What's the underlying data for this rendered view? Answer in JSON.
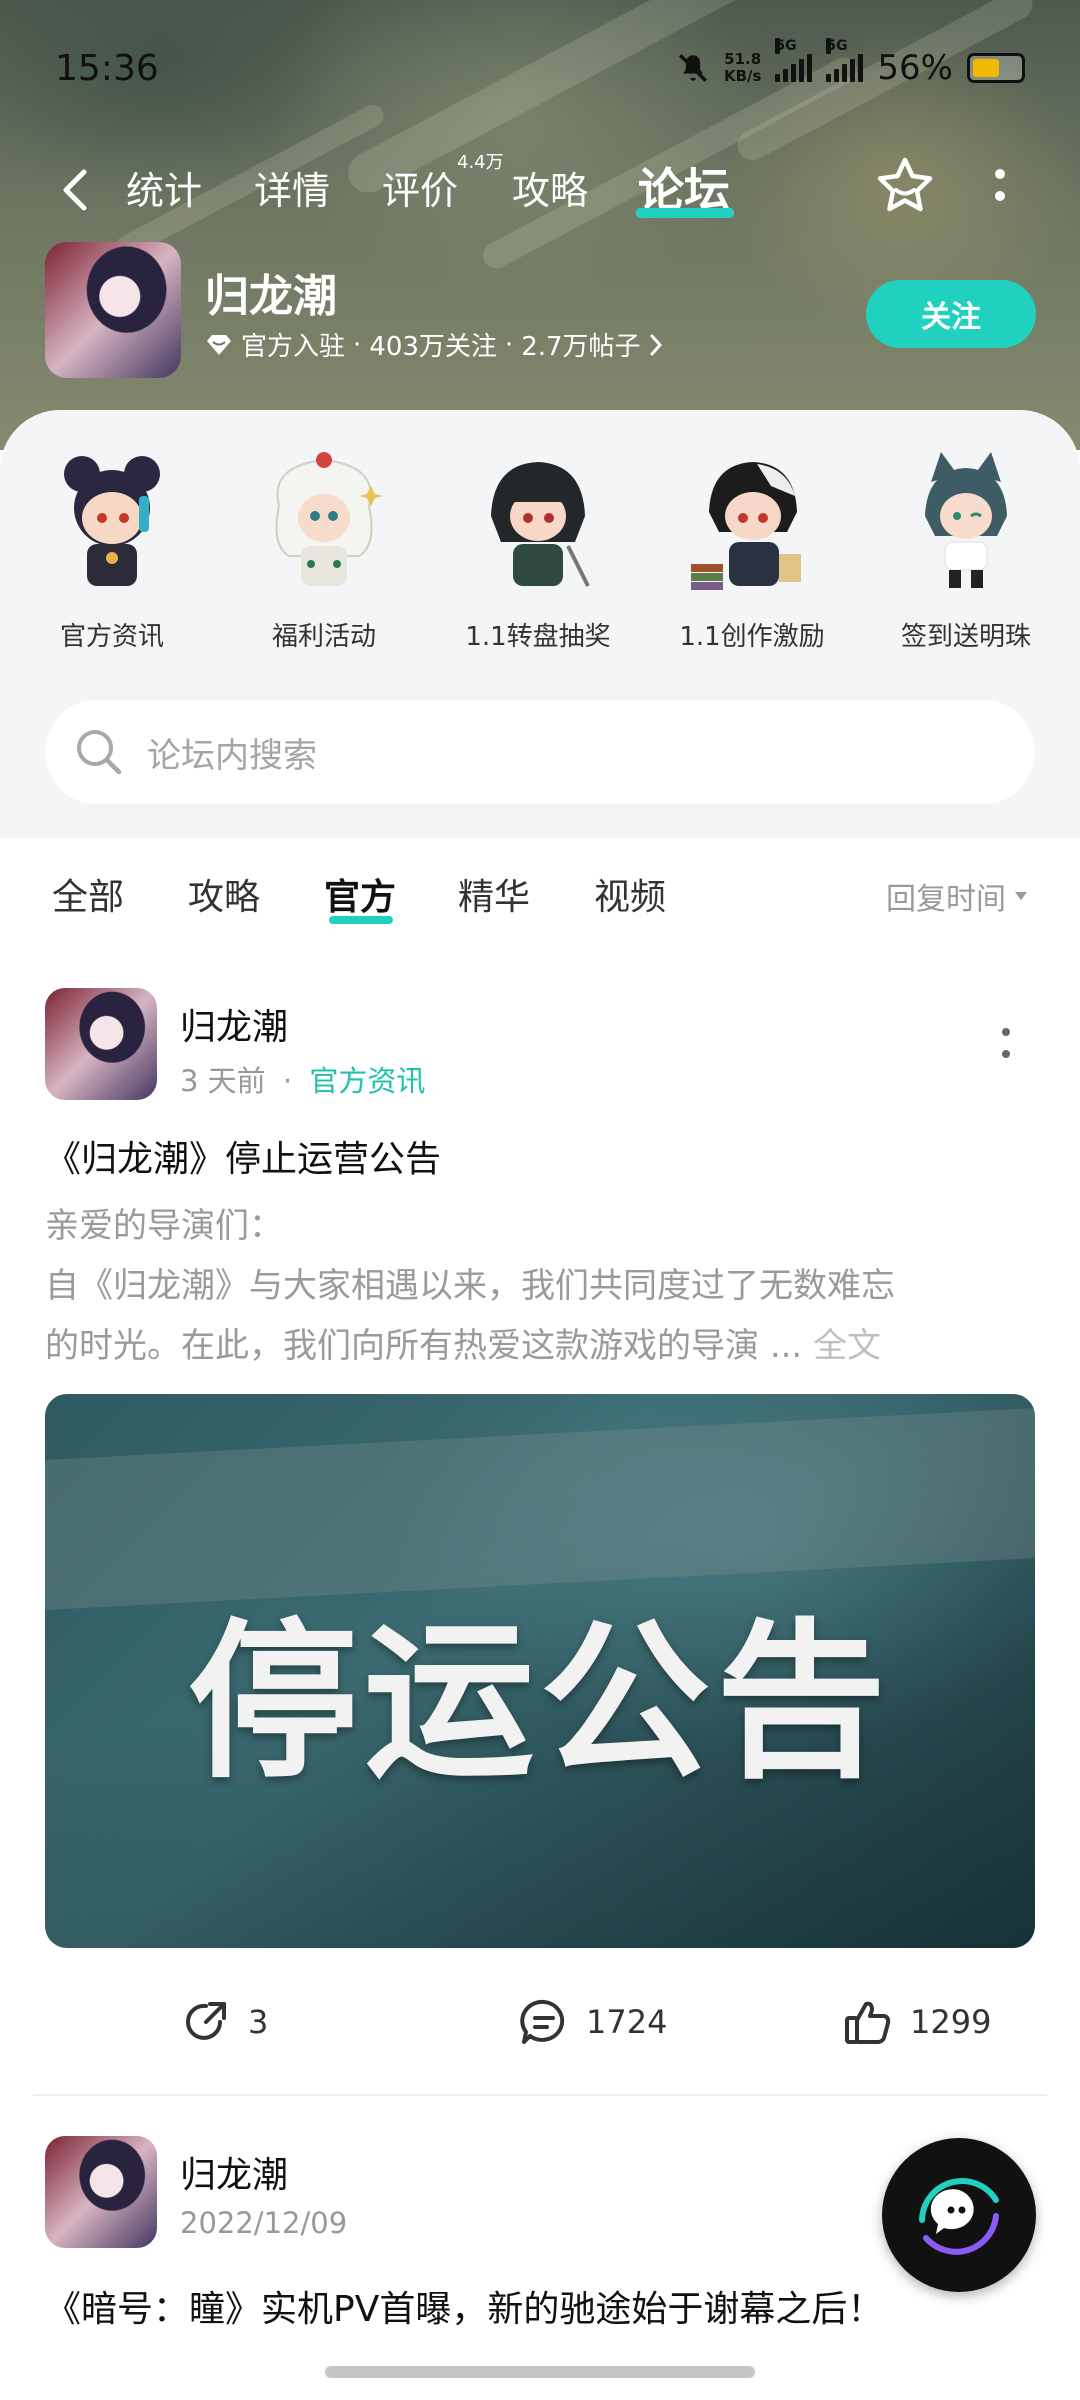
{
  "status_bar": {
    "time": "15:36",
    "net_speed_value": "51.8",
    "net_speed_unit": "KB/s",
    "signal_1": "5G",
    "signal_2": "5G",
    "battery": "56%"
  },
  "top_nav": {
    "tabs": [
      {
        "label": "统计"
      },
      {
        "label": "详情"
      },
      {
        "label": "评价"
      },
      {
        "label": "攻略"
      },
      {
        "label": "论坛"
      }
    ],
    "review_count_badge": "4.4万",
    "active_tab": "论坛"
  },
  "game": {
    "name": "归龙潮",
    "official": "官方入驻",
    "followers": "403万关注",
    "posts": "2.7万帖子",
    "separator": "·",
    "follow_label": "关注"
  },
  "shortcuts": [
    {
      "label": "官方资讯",
      "icon": "chibi-girl-buns"
    },
    {
      "label": "福利活动",
      "icon": "chibi-lion-dance"
    },
    {
      "label": "1.1转盘抽奖",
      "icon": "chibi-dark-hair"
    },
    {
      "label": "1.1创作激励",
      "icon": "chibi-boy-books"
    },
    {
      "label": "签到送明珠",
      "icon": "chibi-cat-girl"
    }
  ],
  "search": {
    "placeholder": "论坛内搜索"
  },
  "filters": {
    "tabs": [
      {
        "label": "全部"
      },
      {
        "label": "攻略"
      },
      {
        "label": "官方"
      },
      {
        "label": "精华"
      },
      {
        "label": "视频"
      }
    ],
    "active": "官方",
    "sort_label": "回复时间"
  },
  "posts": [
    {
      "author": "归龙潮",
      "time": "3 天前",
      "dot": "·",
      "tag": "官方资讯",
      "title": "《归龙潮》停止运营公告",
      "body_line1": "亲爱的导演们：",
      "body_line2": "自《归龙潮》与大家相遇以来，我们共同度过了无数难忘",
      "body_line3": "的时光。在此，我们向所有热爱这款游戏的导演",
      "ellipsis": "...",
      "full_text": "全文",
      "image_text": "停运公告",
      "shares": "3",
      "comments": "1724",
      "likes": "1299"
    },
    {
      "author": "归龙潮",
      "time": "2022/12/09",
      "title": "《暗号：瞳》实机PV首曝，新的驰途始于谢幕之后！"
    }
  ],
  "colors": {
    "accent": "#1fd1be",
    "tag": "#1fc2ad",
    "panel_bg": "#f3f5f6"
  }
}
